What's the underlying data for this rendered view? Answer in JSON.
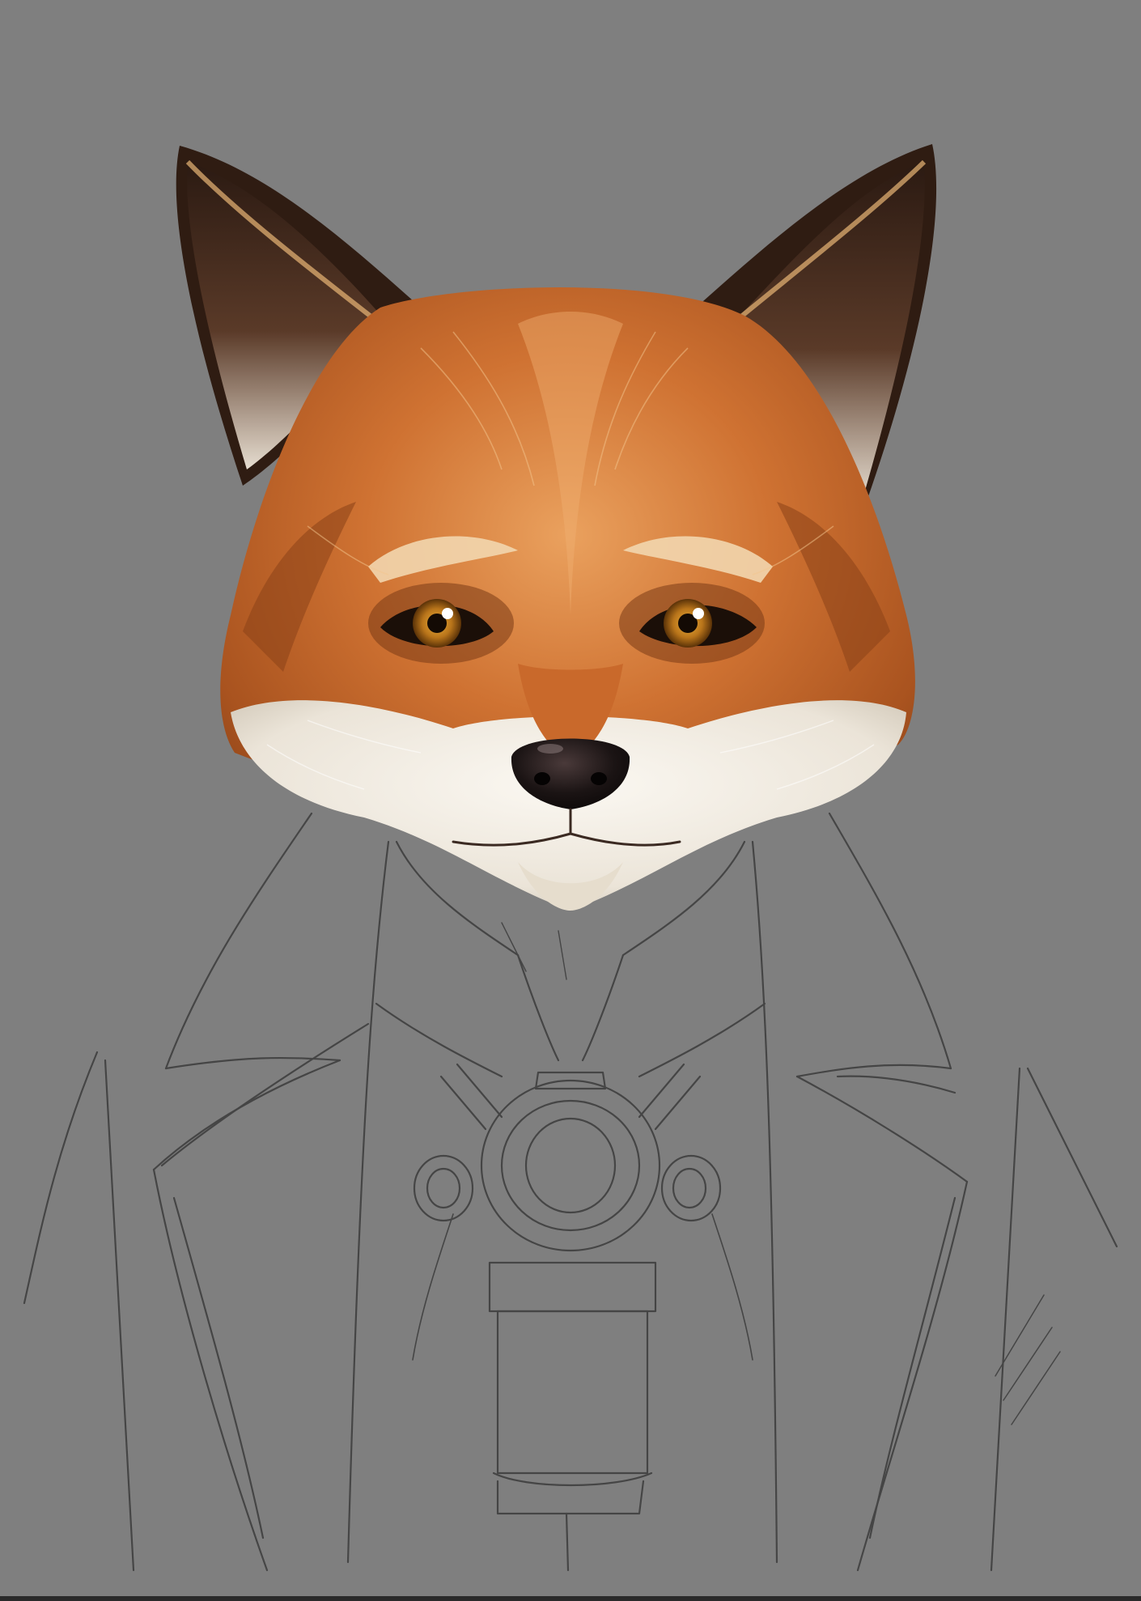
{
  "artwork": {
    "subject": "fox-head-portrait",
    "style": "digital-painting-over-pencil-sketch",
    "colors": {
      "background": "#7f7f7f",
      "fur_orange": "#c8692a",
      "fur_light": "#e59a55",
      "fur_white": "#efe9de",
      "ear_dark": "#3a2418",
      "eye_amber": "#c98a1e",
      "nose": "#1a1212",
      "sketch_line": "#3c3c3c"
    }
  }
}
